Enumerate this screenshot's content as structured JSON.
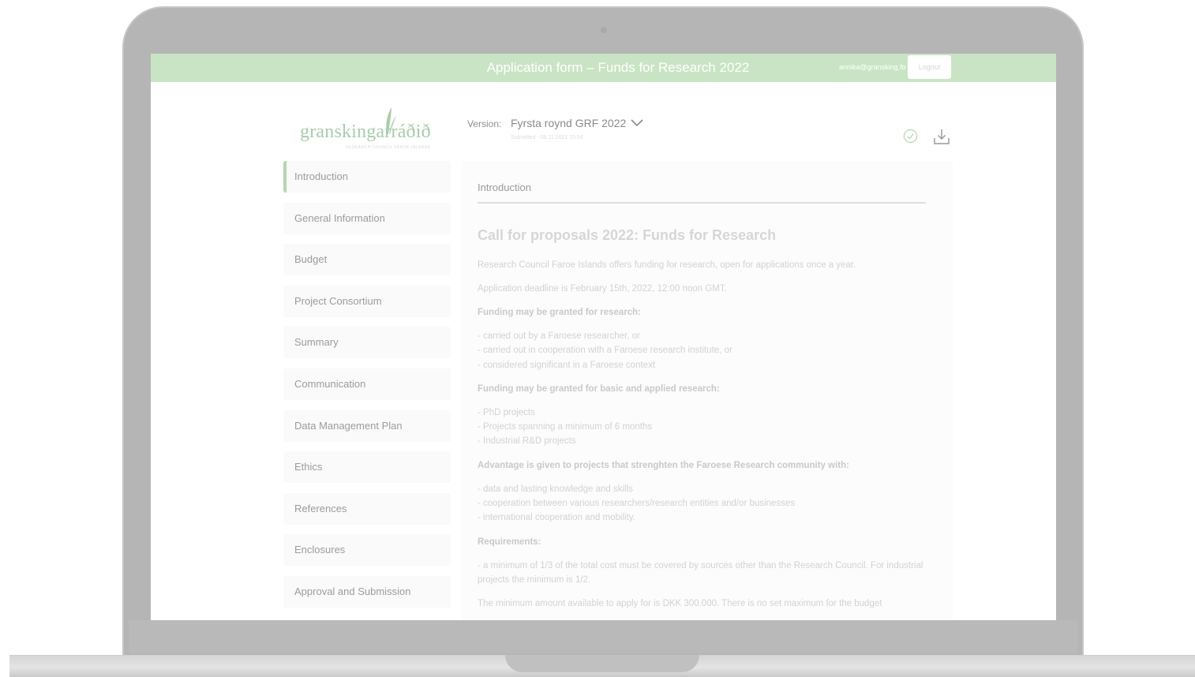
{
  "header": {
    "title": "Application form – Funds for Research 2022",
    "user_email": "annika@gransking.fo",
    "logout_label": "Logout"
  },
  "logo": {
    "name": "granskingarráðið",
    "tagline": "RESEARCH COUNCIL FAROE ISLANDS"
  },
  "version": {
    "label": "Version:",
    "selected": "Fyrsta roynd GRF 2022",
    "submitted": "Submitted - 08.11.2021 15:54"
  },
  "sidebar": {
    "items": [
      {
        "label": "Introduction",
        "active": true
      },
      {
        "label": "General Information"
      },
      {
        "label": "Budget"
      },
      {
        "label": "Project Consortium"
      },
      {
        "label": "Summary"
      },
      {
        "label": "Communication"
      },
      {
        "label": "Data Management Plan"
      },
      {
        "label": "Ethics"
      },
      {
        "label": "References"
      },
      {
        "label": "Enclosures"
      },
      {
        "label": "Approval and Submission"
      }
    ]
  },
  "content": {
    "section_title": "Introduction",
    "heading": "Call for proposals 2022: Funds for Research",
    "p1": "Research Council Faroe Islands offers funding for research, open for applications once a year.",
    "p2": "Application deadline is February 15th, 2022, 12:00 noon GMT.",
    "funding_title": "Funding may be granted for research:",
    "funding_items": [
      "- carried out by a Faroese researcher, or",
      "- carried out in cooperation with a Faroese research institute, or",
      "- considered significant in a Faroese context"
    ],
    "basic_title": "Funding may be granted for basic and applied research:",
    "basic_items": [
      "- PhD projects",
      "- Projects spanning a minimum of 6 months",
      "- Industrial R&D projects"
    ],
    "advantage_title": "Advantage is given to projects that strenghten the Faroese Research community with:",
    "advantage_items": [
      "- data and lasting knowledge and skills",
      "- cooperation between various researchers/research entities and/or businesses",
      "- international cooperation and mobility."
    ],
    "requirements_title": "Requirements:",
    "requirement_text": "-  a minimum of 1/3 of the total cost must be covered by sources other than the Research Council. For industrial projects the minimum is 1/2.",
    "minimum_text": "The minimum amount available to apply for is DKK 300.000. There is no set maximum for the budget"
  },
  "colors": {
    "header_bg": "#c9e4c4",
    "accent": "#b2d8ad",
    "laptop_frame": "#b5b5b5"
  }
}
